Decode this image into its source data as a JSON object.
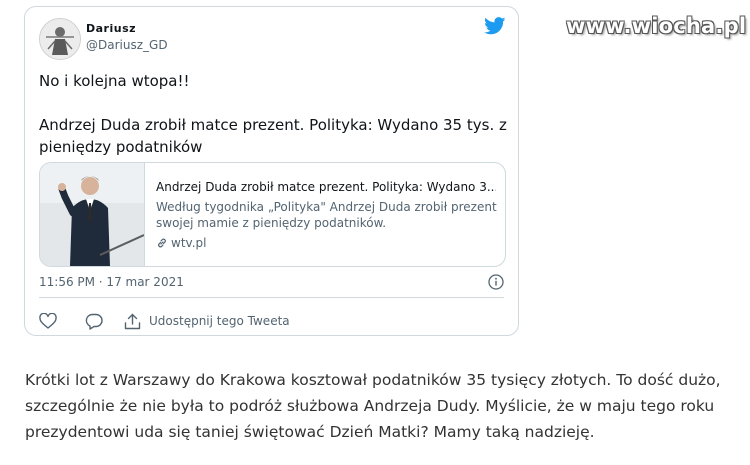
{
  "site": {
    "logo_text": "www.wiocha.pl"
  },
  "tweet": {
    "author_name": "Dariusz",
    "author_handle": "@Dariusz_GD",
    "lines": [
      "No i kolejna wtopa!!",
      "Andrzej Duda zrobił matce prezent. Polityka: Wydano 35 tys. z pieniędzy podatników"
    ],
    "link_card": {
      "title": "Andrzej Duda zrobił matce prezent. Polityka: Wydano 3...",
      "description": "Według tygodnika „Polityka\" Andrzej Duda zrobił prezent swojej mamie z pieniędzy podatników.",
      "domain": "wtv.pl"
    },
    "timestamp": "11:56 PM · 17 mar 2021",
    "share_label": "Udostępnij tego Tweeta"
  },
  "article": {
    "text": "Krótki lot z Warszawy do Krakowa kosztował podatników 35 tysięcy złotych. To dość dużo, szczególnie że nie była to podróż służbowa Andrzeja Dudy. Myślicie, że w maju tego roku prezydentowi uda się taniej świętować Dzień Matki? Mamy taką nadzieję."
  },
  "colors": {
    "twitter_blue": "#1d9bf0",
    "text_primary": "#0f1419",
    "text_secondary": "#536471",
    "border": "#cfd9de"
  },
  "icons": [
    "twitter-bird-icon",
    "info-icon",
    "heart-icon",
    "reply-icon",
    "share-icon",
    "link-icon"
  ]
}
